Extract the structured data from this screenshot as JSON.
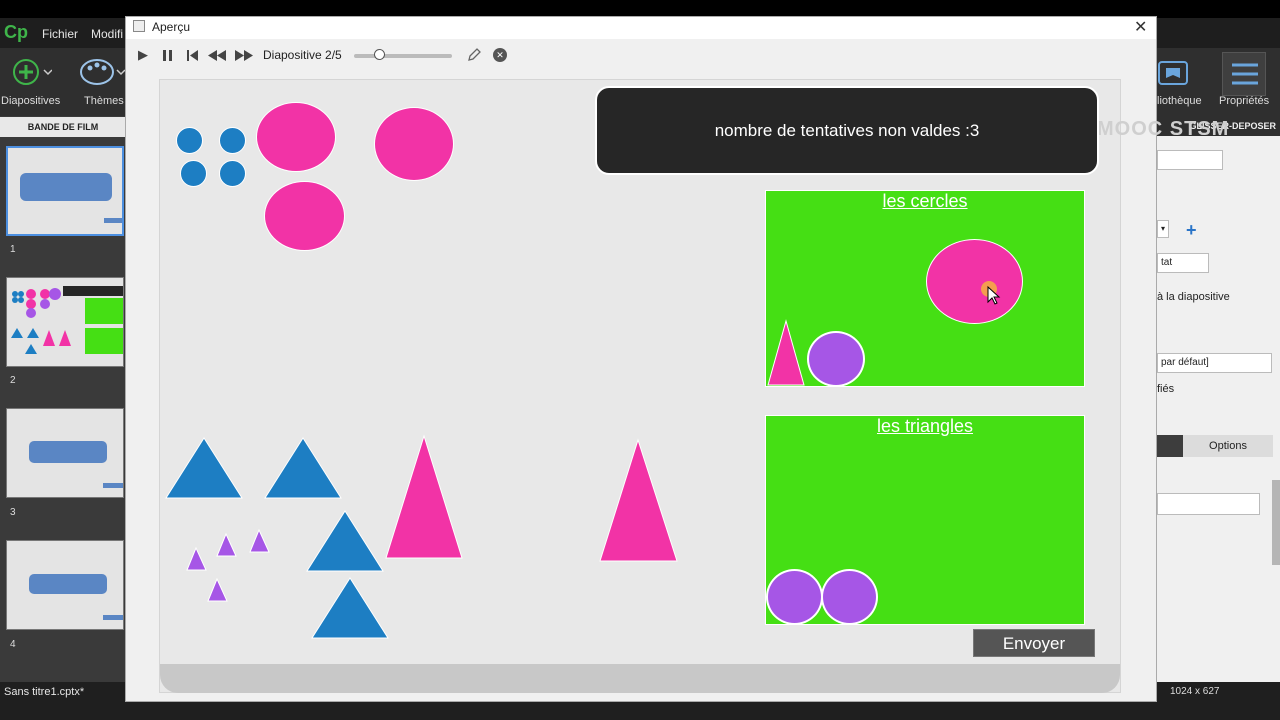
{
  "app": {
    "logo": "Cp",
    "menu": [
      "Fichier",
      "Modifi"
    ],
    "toolbar": {
      "slides_label": "Diapositives",
      "themes_label": "Thèmes",
      "library_label": "liothèque",
      "properties_label": "Propriétés"
    },
    "filmstrip_title": "BANDE DE FILM",
    "thumbnail_numbers": [
      "1",
      "2",
      "3",
      "4"
    ],
    "file_name": "Sans titre1.cptx*",
    "resolution": "1024 x 627",
    "right_panel": {
      "tab": "GLISSER-DEPOSER",
      "field_state": "tat",
      "text_slide": "à la diapositive",
      "select_default": "par défaut]",
      "text_fies": "fiés",
      "options_tab": "Options"
    }
  },
  "preview": {
    "window_title": "Aperçu",
    "slide_counter": "Diapositive 2/5",
    "slider_progress": 0.25,
    "message": "nombre de tentatives non valdes :3",
    "zone_circles_title": "les cercles",
    "zone_triangles_title": "les triangles",
    "send_label": "Envoyer",
    "watermark": "MOOC STSM"
  },
  "colors": {
    "pink": "#f233a6",
    "blue": "#1d7ec3",
    "purple": "#a656e6",
    "green": "#45df14",
    "dark": "#262626"
  }
}
